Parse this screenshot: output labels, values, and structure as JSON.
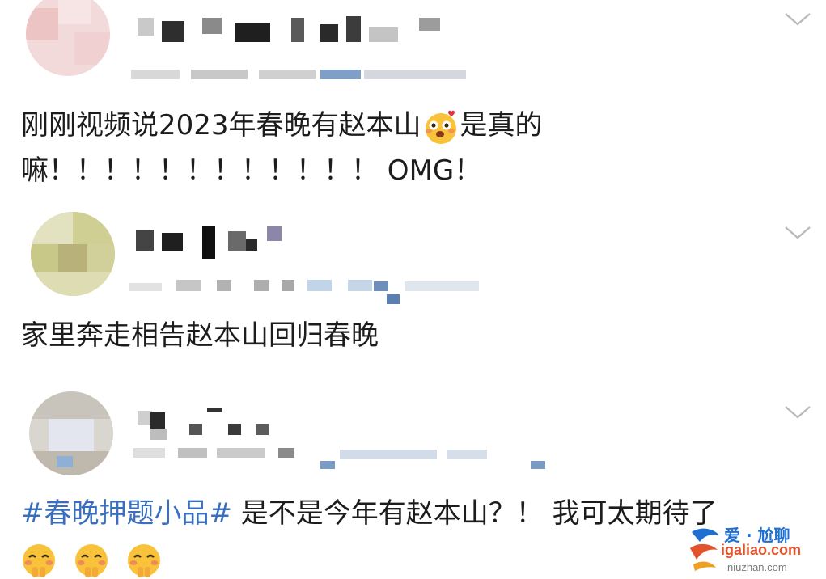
{
  "comments": [
    {
      "text_lines": [
        "刚刚视频说2023年春晚有赵本山",
        "是真的",
        "嘛！！！！！！！！！！！！ OMG！"
      ],
      "text": {
        "line1_before_emoji": "刚刚视频说2023年春晚有赵本山",
        "emoji": "excited-face-emoji",
        "line1_after_emoji": "是真的",
        "line2": "嘛！！！！！！！！！！！！ OMG！"
      },
      "username": "(pixelated)",
      "meta": "(pixelated)"
    },
    {
      "text": {
        "line1": "家里奔走相告赵本山回归春晚"
      },
      "username": "(pixelated)",
      "meta": "(pixelated)"
    },
    {
      "text": {
        "hashtag": "#春晚押题小品#",
        "line1_rest": " 是不是今年有赵本山？！ 我可太期待了",
        "emojis": [
          "blushing-hands-face-emoji",
          "blushing-hands-face-emoji",
          "blushing-hands-face-emoji"
        ]
      },
      "username": "(pixelated)",
      "meta": "(pixelated)"
    }
  ],
  "watermark": {
    "brand": "爱 · 尬聊",
    "url": "igaliao.com",
    "sub": "niuzhan.com"
  },
  "colors": {
    "hashtag": "#3a6fbf",
    "text": "#1c1c1c",
    "chevron": "#b8b8b8"
  }
}
